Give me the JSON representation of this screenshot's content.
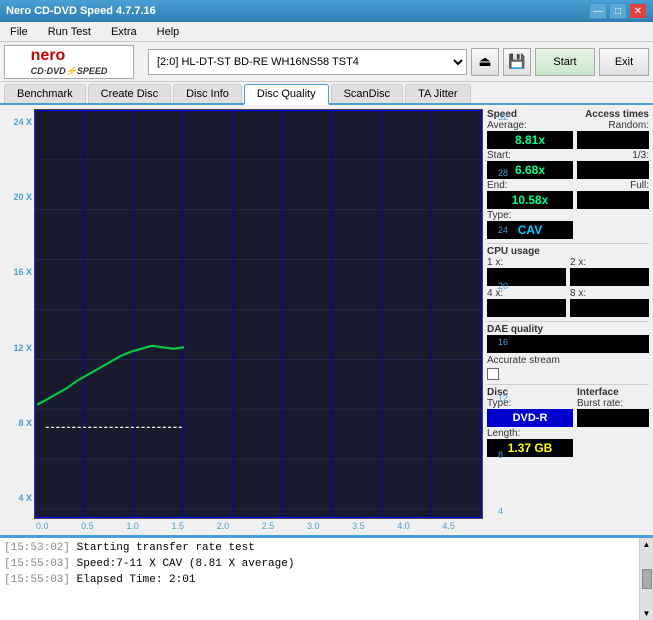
{
  "app": {
    "title": "Nero CD-DVD Speed 4.7.7.16",
    "titlebar_controls": [
      "—",
      "□",
      "✕"
    ]
  },
  "menu": {
    "items": [
      "File",
      "Run Test",
      "Extra",
      "Help"
    ]
  },
  "toolbar": {
    "drive_label": "[2:0]  HL-DT-ST BD-RE  WH16NS58 TST4",
    "start_label": "Start",
    "exit_label": "Exit"
  },
  "tabs": [
    {
      "id": "benchmark",
      "label": "Benchmark",
      "active": false
    },
    {
      "id": "create-disc",
      "label": "Create Disc",
      "active": false
    },
    {
      "id": "disc-info",
      "label": "Disc Info",
      "active": false
    },
    {
      "id": "disc-quality",
      "label": "Disc Quality",
      "active": true
    },
    {
      "id": "scandisc",
      "label": "ScanDisc",
      "active": false
    },
    {
      "id": "ta-jitter",
      "label": "TA Jitter",
      "active": false
    }
  ],
  "chart": {
    "left_axis_labels": [
      "24 X",
      "20 X",
      "16 X",
      "12 X",
      "8 X",
      "4 X"
    ],
    "right_axis_labels": [
      "32",
      "28",
      "24",
      "20",
      "16",
      "12",
      "8",
      "4"
    ],
    "bottom_axis_labels": [
      "0.0",
      "0.5",
      "1.0",
      "1.5",
      "2.0",
      "2.5",
      "3.0",
      "3.5",
      "4.0",
      "4.5"
    ]
  },
  "stats": {
    "speed": {
      "label": "Speed",
      "average_label": "Average:",
      "average_value": "8.81x",
      "start_label": "Start:",
      "start_value": "6.68x",
      "end_label": "End:",
      "end_value": "10.58x",
      "type_label": "Type:",
      "type_value": "CAV"
    },
    "access_times": {
      "label": "Access times",
      "random_label": "Random:",
      "random_value": "",
      "one_third_label": "1/3:",
      "one_third_value": "",
      "full_label": "Full:",
      "full_value": ""
    },
    "cpu_usage": {
      "label": "CPU usage",
      "1x_label": "1 x:",
      "1x_value": "",
      "2x_label": "2 x:",
      "2x_value": "",
      "4x_label": "4 x:",
      "4x_value": "",
      "8x_label": "8 x:",
      "8x_value": ""
    },
    "dae_quality": {
      "label": "DAE quality",
      "value": ""
    },
    "accurate_stream": {
      "label": "Accurate stream",
      "checked": false
    },
    "disc": {
      "type_label": "Disc",
      "type_sub": "Type:",
      "type_value": "DVD-R",
      "length_label": "Length:",
      "length_value": "1.37 GB"
    },
    "interface": {
      "label": "Interface",
      "burst_label": "Burst rate:",
      "burst_value": ""
    }
  },
  "log": {
    "entries": [
      {
        "time": "[15:53:02]",
        "text": "Starting transfer rate test"
      },
      {
        "time": "[15:55:03]",
        "text": "Speed:7-11 X CAV (8.81 X average)"
      },
      {
        "time": "[15:55:03]",
        "text": "Elapsed Time: 2:01"
      }
    ]
  }
}
